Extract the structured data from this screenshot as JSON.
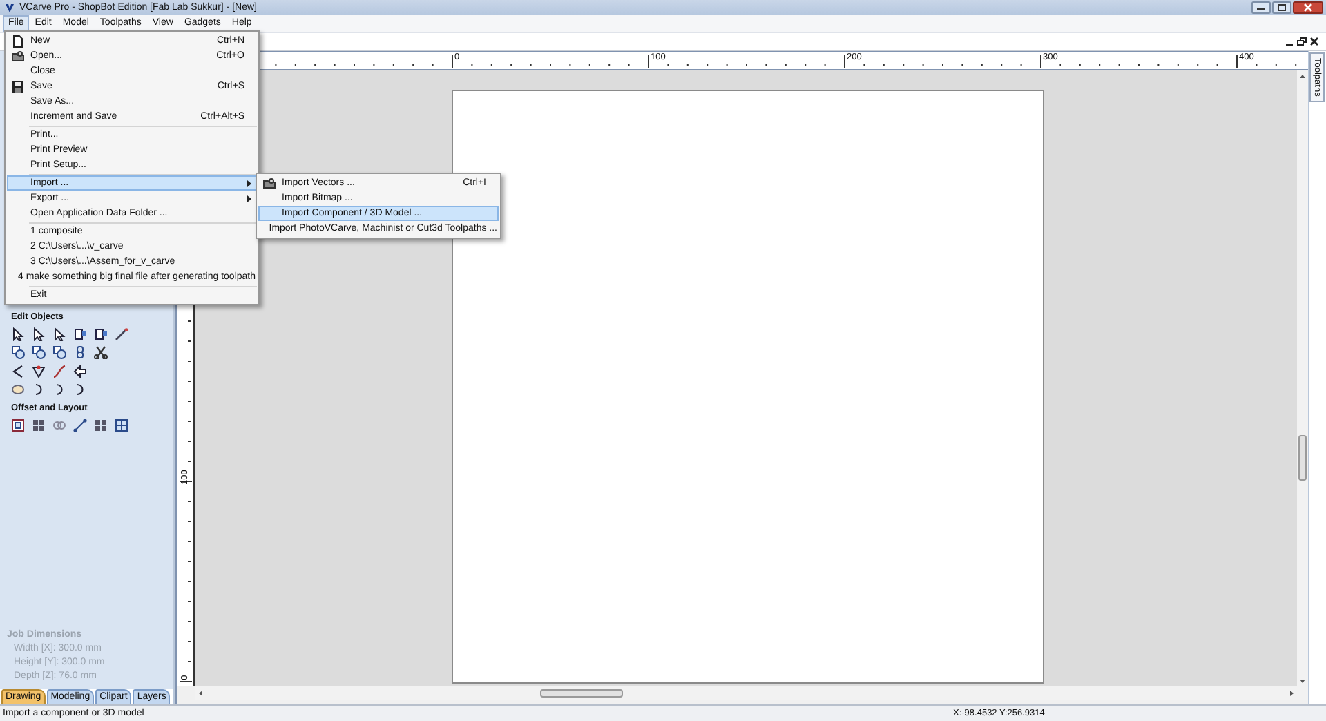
{
  "window": {
    "title": "VCarve Pro - ShopBot Edition [Fab Lab Sukkur] - [New]"
  },
  "menu_bar": [
    {
      "label": "File",
      "selected": true
    },
    {
      "label": "Edit",
      "selected": false
    },
    {
      "label": "Model",
      "selected": false
    },
    {
      "label": "Toolpaths",
      "selected": false
    },
    {
      "label": "View",
      "selected": false
    },
    {
      "label": "Gadgets",
      "selected": false
    },
    {
      "label": "Help",
      "selected": false
    }
  ],
  "file_menu": {
    "groups": [
      [
        {
          "label": "New",
          "shortcut": "Ctrl+N",
          "icon": true,
          "submenu": false,
          "selected": false
        },
        {
          "label": "Open...",
          "shortcut": "Ctrl+O",
          "icon": true,
          "submenu": false,
          "selected": false
        },
        {
          "label": "Close",
          "icon": false,
          "submenu": false,
          "selected": false
        },
        {
          "label": "Save",
          "shortcut": "Ctrl+S",
          "icon": true,
          "submenu": false,
          "selected": false
        },
        {
          "label": "Save As...",
          "icon": false,
          "submenu": false,
          "selected": false
        },
        {
          "label": "Increment and Save",
          "shortcut": "Ctrl+Alt+S",
          "icon": false,
          "submenu": false,
          "selected": false
        }
      ],
      [
        {
          "label": "Print...",
          "icon": false,
          "submenu": false,
          "selected": false
        },
        {
          "label": "Print Preview",
          "icon": false,
          "submenu": false,
          "selected": false
        },
        {
          "label": "Print Setup...",
          "icon": false,
          "submenu": false,
          "selected": false
        }
      ],
      [
        {
          "label": "Import ...",
          "icon": false,
          "submenu": true,
          "selected": true
        },
        {
          "label": "Export ...",
          "icon": false,
          "submenu": true,
          "selected": false
        },
        {
          "label": "Open Application Data Folder ...",
          "icon": false,
          "submenu": false,
          "selected": false
        }
      ],
      [
        {
          "label": "1 composite",
          "icon": false,
          "submenu": false,
          "selected": false
        },
        {
          "label": "2 C:\\Users\\...\\v_carve",
          "icon": false,
          "submenu": false,
          "selected": false
        },
        {
          "label": "3 C:\\Users\\...\\Assem_for_v_carve",
          "icon": false,
          "submenu": false,
          "selected": false
        },
        {
          "label": "4 make something big final file after generating toolpath",
          "icon": false,
          "submenu": false,
          "selected": false
        }
      ],
      [
        {
          "label": "Exit",
          "icon": false,
          "submenu": false,
          "selected": false
        }
      ]
    ]
  },
  "import_submenu": [
    {
      "label": "Import Vectors ...",
      "shortcut": "Ctrl+I",
      "icon": true,
      "selected": false
    },
    {
      "label": "Import Bitmap ...",
      "icon": false,
      "selected": false
    },
    {
      "label": "Import Component / 3D Model ...",
      "icon": false,
      "selected": true
    },
    {
      "label": "Import PhotoVCarve, Machinist or Cut3d Toolpaths ...",
      "icon": false,
      "selected": false
    }
  ],
  "tool_sections": [
    {
      "title": "Edit Objects"
    },
    {
      "title": "Offset and Layout"
    }
  ],
  "job_dimensions": {
    "title": "Job Dimensions",
    "lines": [
      "Width [X]: 300.0 mm",
      "Height [Y]: 300.0 mm",
      "Depth [Z]: 76.0 mm"
    ]
  },
  "panel_tabs": [
    {
      "label": "Drawing",
      "selected": true
    },
    {
      "label": "Modeling",
      "selected": false
    },
    {
      "label": "Clipart",
      "selected": false
    },
    {
      "label": "Layers",
      "selected": false
    }
  ],
  "rulers": {
    "horizontal": [
      "0",
      "100",
      "200",
      "300",
      "400"
    ],
    "vertical": [
      "100",
      "0"
    ]
  },
  "side_tab": {
    "label": "Toolpaths"
  },
  "status_bar": {
    "message": "Import a component or 3D model",
    "coordinates": "X:-98.4532 Y:256.9314"
  }
}
